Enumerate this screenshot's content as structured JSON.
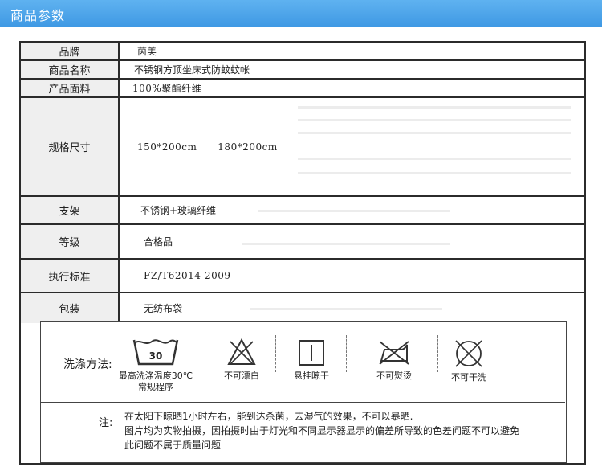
{
  "header": {
    "title": "商品参数",
    "bar_color": "#4aa3ea"
  },
  "params": [
    {
      "label": "品牌",
      "value": "茵美"
    },
    {
      "label": "商品名称",
      "value": "不锈钢方顶坐床式防蚊蚊帐"
    },
    {
      "label": "产品面料",
      "value": "100%聚酯纤维"
    },
    {
      "label": "规格尺寸",
      "value": "150*200cm      180*200cm"
    },
    {
      "label": "支架",
      "value": "不锈钢+玻璃纤维"
    },
    {
      "label": "等级",
      "value": "合格品"
    },
    {
      "label": "执行标准",
      "value": "FZ/T62014-2009"
    },
    {
      "label": "包装",
      "value": "无纺布袋"
    }
  ],
  "care": {
    "label": "洗涤方法:",
    "items": [
      {
        "icon": "wash-30-icon",
        "number": "30",
        "line1": "最高洗涤温度30℃",
        "line2": "常规程序"
      },
      {
        "icon": "no-bleach-icon",
        "line1": "不可漂白"
      },
      {
        "icon": "line-dry-icon",
        "line1": "悬挂晾干"
      },
      {
        "icon": "no-iron-icon",
        "line1": "不可熨烫"
      },
      {
        "icon": "no-dry-clean-icon",
        "line1": "不可干洗"
      }
    ]
  },
  "note": {
    "head": "注:",
    "lines": [
      "在太阳下晾晒1小时左右，能到达杀菌，去湿气的效果，不可以暴晒.",
      "图片均为实物拍摄，因拍摄时由于灯光和不同显示器显示的偏差所导致的色差问题不可以避免",
      "此问题不属于质量问题"
    ]
  }
}
